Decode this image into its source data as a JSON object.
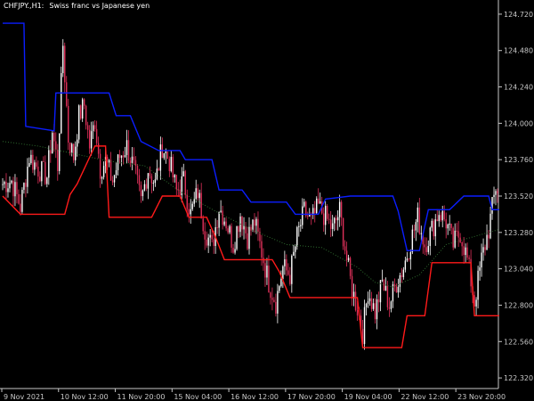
{
  "chart": {
    "label_symbol": "CHFJPY.,H1:",
    "label_name": "Swiss franc vs Japanese yen"
  },
  "colors": {
    "background": "#000000",
    "axis": "#c8c8c8",
    "upper_band": "#0b1eff",
    "lower_band": "#ff1a1a",
    "middle_line": "#2e6b2e",
    "bull_candle": "#ffffff",
    "bear_candle": "#e0305a"
  },
  "chart_data": {
    "type": "line",
    "title": "",
    "ylim": [
      122.36,
      124.66
    ],
    "y_ticks": [
      "124.720",
      "124.480",
      "124.240",
      "124.000",
      "123.760",
      "123.520",
      "123.280",
      "123.040",
      "122.800",
      "122.560",
      "122.320"
    ],
    "y_tick_values": [
      124.72,
      124.48,
      124.24,
      124.0,
      123.76,
      123.52,
      123.28,
      123.04,
      122.8,
      122.56,
      122.32
    ],
    "x_ticks": [
      "9 Nov 2021",
      "10 Nov 12:00",
      "11 Nov 20:00",
      "15 Nov 04:00",
      "16 Nov 12:00",
      "17 Nov 20:00",
      "19 Nov 04:00",
      "22 Nov 12:00",
      "23 Nov 20:00"
    ],
    "x_tick_bars": [
      0,
      32,
      64,
      96,
      128,
      160,
      192,
      224,
      256
    ],
    "bar_count": 280,
    "series": [
      {
        "name": "",
        "role": "upper-band",
        "points": [
          [
            0,
            124.66
          ],
          [
            12,
            124.66
          ],
          [
            13,
            123.98
          ],
          [
            29,
            123.95
          ],
          [
            30,
            124.2
          ],
          [
            60,
            124.2
          ],
          [
            64,
            124.05
          ],
          [
            72,
            124.05
          ],
          [
            78,
            123.88
          ],
          [
            88,
            123.82
          ],
          [
            100,
            123.82
          ],
          [
            103,
            123.76
          ],
          [
            118,
            123.76
          ],
          [
            122,
            123.56
          ],
          [
            135,
            123.56
          ],
          [
            140,
            123.48
          ],
          [
            160,
            123.48
          ],
          [
            165,
            123.4
          ],
          [
            178,
            123.4
          ],
          [
            182,
            123.5
          ],
          [
            196,
            123.52
          ],
          [
            205,
            123.52
          ],
          [
            220,
            123.52
          ],
          [
            223,
            123.42
          ],
          [
            228,
            123.16
          ],
          [
            235,
            123.16
          ],
          [
            240,
            123.43
          ],
          [
            252,
            123.43
          ],
          [
            260,
            123.52
          ],
          [
            274,
            123.52
          ],
          [
            276,
            123.43
          ],
          [
            280,
            123.43
          ]
        ]
      },
      {
        "name": "",
        "role": "lower-band",
        "points": [
          [
            0,
            123.52
          ],
          [
            10,
            123.4
          ],
          [
            35,
            123.4
          ],
          [
            38,
            123.53
          ],
          [
            42,
            123.6
          ],
          [
            52,
            123.85
          ],
          [
            58,
            123.85
          ],
          [
            60,
            123.38
          ],
          [
            84,
            123.38
          ],
          [
            90,
            123.52
          ],
          [
            100,
            123.52
          ],
          [
            105,
            123.38
          ],
          [
            115,
            123.38
          ],
          [
            120,
            123.25
          ],
          [
            125,
            123.1
          ],
          [
            152,
            123.1
          ],
          [
            156,
            123.02
          ],
          [
            162,
            122.85
          ],
          [
            200,
            122.85
          ],
          [
            203,
            122.52
          ],
          [
            225,
            122.52
          ],
          [
            228,
            122.73
          ],
          [
            238,
            122.73
          ],
          [
            242,
            123.08
          ],
          [
            264,
            123.08
          ],
          [
            266,
            122.73
          ],
          [
            280,
            122.73
          ]
        ]
      },
      {
        "name": "",
        "role": "middle-line",
        "points": [
          [
            0,
            123.88
          ],
          [
            20,
            123.85
          ],
          [
            40,
            123.8
          ],
          [
            60,
            123.75
          ],
          [
            80,
            123.72
          ],
          [
            100,
            123.55
          ],
          [
            120,
            123.42
          ],
          [
            140,
            123.3
          ],
          [
            160,
            123.2
          ],
          [
            180,
            123.18
          ],
          [
            200,
            123.05
          ],
          [
            210,
            122.95
          ],
          [
            220,
            122.92
          ],
          [
            235,
            123.0
          ],
          [
            250,
            123.2
          ],
          [
            265,
            123.25
          ],
          [
            280,
            123.3
          ]
        ]
      },
      {
        "name": "",
        "role": "price-path",
        "points": [
          [
            0,
            123.6
          ],
          [
            5,
            123.62
          ],
          [
            10,
            123.45
          ],
          [
            15,
            123.78
          ],
          [
            20,
            123.7
          ],
          [
            25,
            123.65
          ],
          [
            28,
            123.95
          ],
          [
            31,
            123.72
          ],
          [
            34,
            124.52
          ],
          [
            37,
            123.9
          ],
          [
            40,
            123.78
          ],
          [
            43,
            124.05
          ],
          [
            46,
            124.12
          ],
          [
            49,
            123.85
          ],
          [
            52,
            124.02
          ],
          [
            55,
            123.7
          ],
          [
            58,
            123.75
          ],
          [
            62,
            123.62
          ],
          [
            66,
            123.78
          ],
          [
            70,
            123.85
          ],
          [
            74,
            123.7
          ],
          [
            78,
            123.48
          ],
          [
            82,
            123.7
          ],
          [
            86,
            123.6
          ],
          [
            90,
            123.85
          ],
          [
            94,
            123.75
          ],
          [
            98,
            123.55
          ],
          [
            102,
            123.62
          ],
          [
            106,
            123.4
          ],
          [
            110,
            123.55
          ],
          [
            114,
            123.3
          ],
          [
            118,
            123.18
          ],
          [
            122,
            123.45
          ],
          [
            126,
            123.35
          ],
          [
            130,
            123.2
          ],
          [
            134,
            123.4
          ],
          [
            138,
            123.25
          ],
          [
            142,
            123.35
          ],
          [
            146,
            123.15
          ],
          [
            150,
            122.95
          ],
          [
            154,
            122.82
          ],
          [
            158,
            123.05
          ],
          [
            162,
            123.0
          ],
          [
            166,
            123.25
          ],
          [
            170,
            123.42
          ],
          [
            174,
            123.35
          ],
          [
            178,
            123.45
          ],
          [
            182,
            123.38
          ],
          [
            186,
            123.3
          ],
          [
            190,
            123.42
          ],
          [
            194,
            123.1
          ],
          [
            197,
            122.9
          ],
          [
            200,
            122.78
          ],
          [
            203,
            122.62
          ],
          [
            206,
            122.9
          ],
          [
            210,
            122.75
          ],
          [
            214,
            122.95
          ],
          [
            218,
            122.8
          ],
          [
            222,
            122.95
          ],
          [
            226,
            123.05
          ],
          [
            230,
            123.22
          ],
          [
            234,
            123.38
          ],
          [
            238,
            123.2
          ],
          [
            242,
            123.3
          ],
          [
            246,
            123.42
          ],
          [
            250,
            123.35
          ],
          [
            254,
            123.2
          ],
          [
            258,
            123.28
          ],
          [
            262,
            123.1
          ],
          [
            266,
            122.82
          ],
          [
            270,
            123.1
          ],
          [
            274,
            123.3
          ],
          [
            278,
            123.58
          ],
          [
            280,
            123.55
          ]
        ]
      }
    ]
  }
}
